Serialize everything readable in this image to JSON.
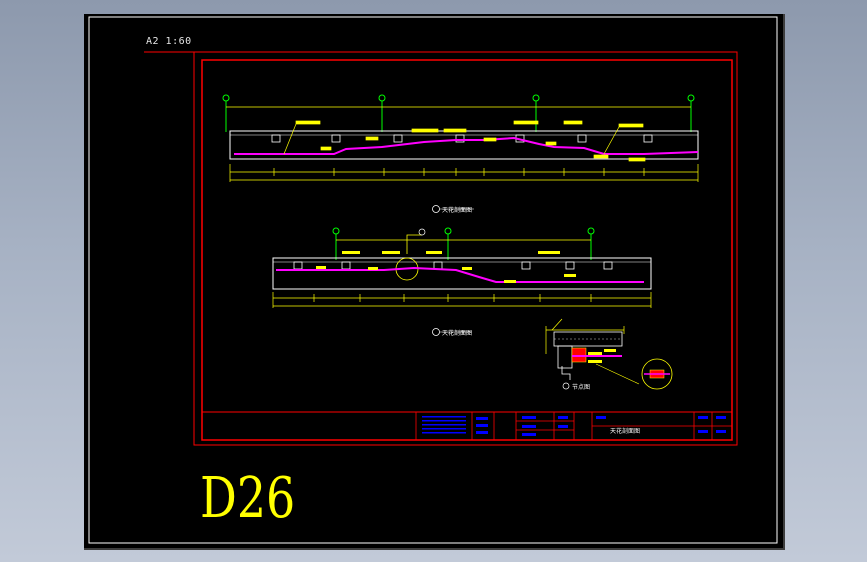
{
  "sheet": {
    "scale_label": "A2 1:60",
    "drawing_label": "D26"
  },
  "captions": {
    "section_1": "天花剖面图",
    "section_2": "天花剖面图",
    "detail": "节点图",
    "title_block_name": "天花剖面图"
  },
  "colors": {
    "background": "#000000",
    "frame": "#ff0000",
    "section": "#ffffff",
    "dimension": "#ffff00",
    "fill": "#ff00ff",
    "axis": "#00ff00",
    "outer_border": "#ffffff",
    "title_block_text": "#0000ff"
  }
}
